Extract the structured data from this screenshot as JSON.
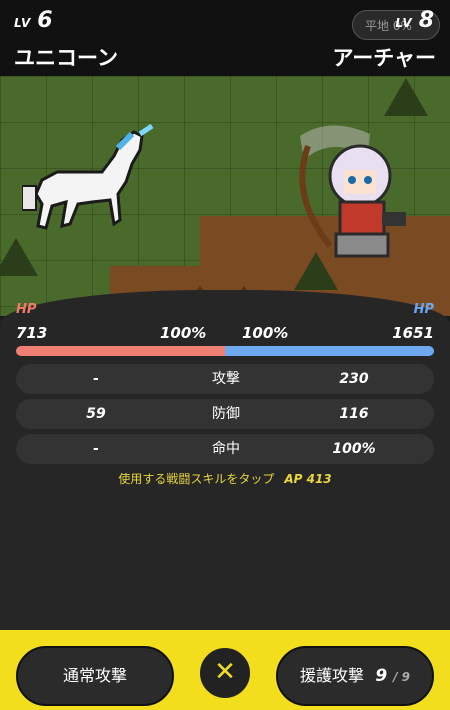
{
  "header": {
    "lv_prefix": "LV",
    "left": {
      "level": "6",
      "name": "ユニコーン"
    },
    "right": {
      "level": "8",
      "name": "アーチャー"
    },
    "terrain": "平地 0%"
  },
  "stats": {
    "hp_label": "HP",
    "left_hp": "713",
    "left_pct": "100%",
    "right_pct": "100%",
    "right_hp": "1651",
    "hp_split_fraction": 0.5,
    "rows": [
      {
        "left": "-",
        "label": "攻撃",
        "right": "230"
      },
      {
        "left": "59",
        "label": "防御",
        "right": "116"
      },
      {
        "left": "-",
        "label": "命中",
        "right": "100%"
      }
    ]
  },
  "hint": {
    "text": "使用する戦闘スキルをタップ",
    "ap": "AP 413"
  },
  "actions": {
    "normal": "通常攻撃",
    "support": "援護攻撃",
    "support_count": "9",
    "support_max": "/ 9",
    "close": "✕"
  },
  "colors": {
    "accent_yellow": "#f2de1c",
    "hp_red": "#ef7f72",
    "hp_blue": "#6ea8ee"
  }
}
